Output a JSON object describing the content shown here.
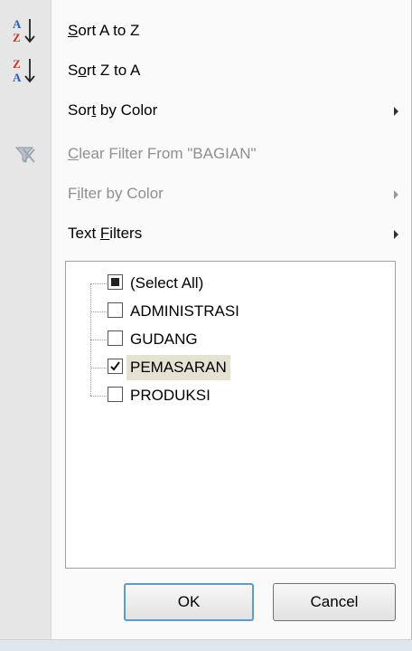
{
  "menu": {
    "sort_az": {
      "pre": "",
      "key": "S",
      "rest": "ort A to Z"
    },
    "sort_za": {
      "pre": "S",
      "key": "o",
      "rest": "rt Z to A"
    },
    "sort_color": {
      "pre": "Sor",
      "key": "t",
      "rest": " by Color"
    },
    "clear_filter": {
      "pre": "",
      "key": "C",
      "rest": "lear Filter From \"BAGIAN\""
    },
    "filter_color": {
      "pre": "F",
      "key": "i",
      "rest": "lter by Color"
    },
    "text_filters": {
      "pre": "Text ",
      "key": "F",
      "rest": "ilters"
    }
  },
  "icons": {
    "sort_az": "sort-ascending-icon",
    "sort_za": "sort-descending-icon",
    "clear_filter": "clear-filter-icon"
  },
  "list": {
    "items": [
      {
        "label": "(Select All)",
        "state": "partial"
      },
      {
        "label": "ADMINISTRASI",
        "state": "unchecked"
      },
      {
        "label": "GUDANG",
        "state": "unchecked"
      },
      {
        "label": "PEMASARAN",
        "state": "checked",
        "selected": true
      },
      {
        "label": "PRODUKSI",
        "state": "unchecked"
      }
    ]
  },
  "buttons": {
    "ok": "OK",
    "cancel": "Cancel"
  },
  "colors": {
    "sort_blue": "#2a5db0",
    "sort_red": "#c0392b",
    "disabled_text": "#8f8f8f"
  }
}
